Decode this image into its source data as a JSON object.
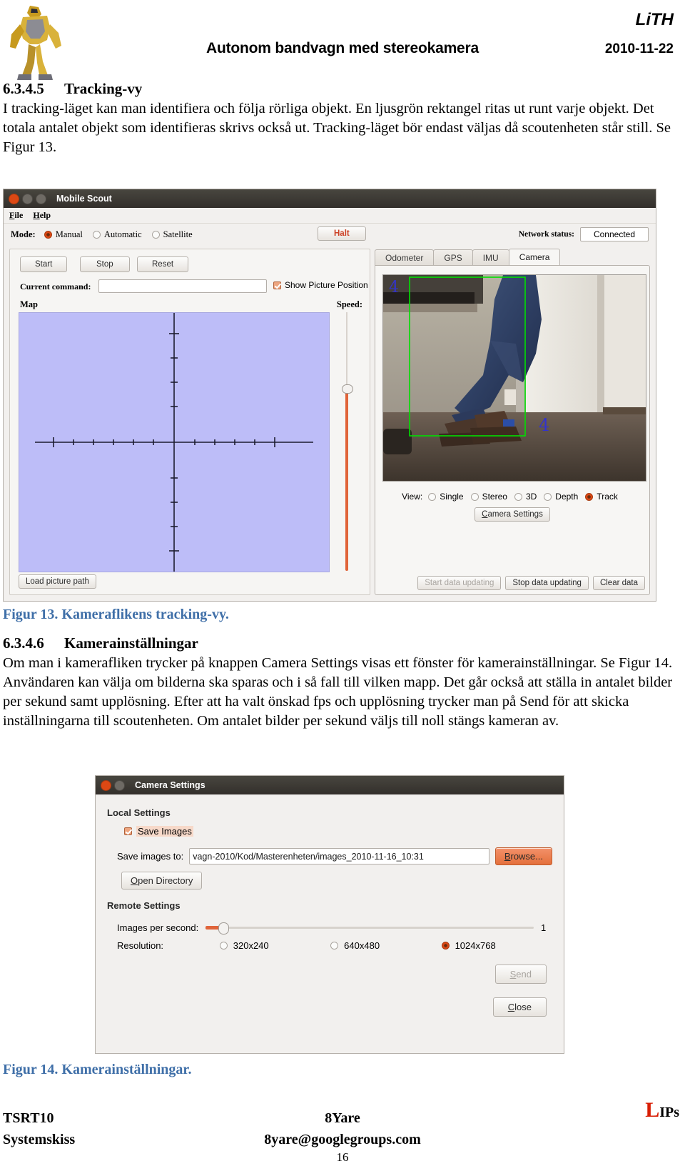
{
  "header": {
    "title": "Autonom bandvagn med stereokamera",
    "org": "LiTH",
    "date": "2010-11-22",
    "logo_alt": "robot-logo"
  },
  "section1": {
    "number": "6.3.4.5",
    "heading": "Tracking-vy",
    "paragraph": "I tracking-läget kan man identifiera och följa rörliga objekt. En ljusgrön rektangel ritas ut runt varje objekt. Det totala antalet objekt som identifieras skrivs också ut. Tracking-läget bör endast väljas då scoutenheten står still. Se Figur 13."
  },
  "figure13": {
    "caption": "Figur 13. Kameraflikens tracking-vy.",
    "window": {
      "title": "Mobile Scout",
      "menu": [
        "File",
        "Help"
      ],
      "mode_label": "Mode:",
      "mode_options": [
        "Manual",
        "Automatic",
        "Satellite"
      ],
      "mode_selected": "Manual",
      "halt_button": "Halt",
      "network_label": "Network status:",
      "network_value": "Connected",
      "buttons": [
        "Start",
        "Stop",
        "Reset"
      ],
      "current_command_label": "Current command:",
      "current_command_value": "",
      "show_picture_position": "Show Picture Position",
      "show_picture_position_checked": true,
      "map_label": "Map",
      "speed_label": "Speed:",
      "load_picture_path": "Load picture path",
      "tabs": [
        "Odometer",
        "GPS",
        "IMU",
        "Camera"
      ],
      "active_tab": "Camera",
      "view_label": "View:",
      "view_options": [
        "Single",
        "Stereo",
        "3D",
        "Depth",
        "Track"
      ],
      "view_selected": "Track",
      "camera_settings_button": "Camera Settings",
      "data_buttons": [
        "Start data updating",
        "Stop data updating",
        "Clear data"
      ],
      "data_buttons_disabled": [
        "Start data updating"
      ],
      "tracking_overlay_labels": [
        "4",
        "4"
      ],
      "tracking_rect_color": "#00e000"
    }
  },
  "section2": {
    "number": "6.3.4.6",
    "heading": "Kamerainställningar",
    "paragraph": "Om man i kamerafliken trycker på knappen Camera Settings visas ett fönster för kamerainställningar. Se Figur 14. Användaren kan välja om bilderna ska sparas och i så fall till vilken mapp. Det går också att ställa in antalet bilder per sekund samt upplösning. Efter att ha valt önskad fps och upplösning trycker man på Send för att skicka inställningarna till scoutenheten. Om antalet bilder per sekund väljs till noll stängs kameran av."
  },
  "figure14": {
    "caption": "Figur 14. Kamerainställningar.",
    "dialog": {
      "title": "Camera Settings",
      "local_settings": "Local Settings",
      "save_images_label": "Save Images",
      "save_images_checked": true,
      "save_images_to_label": "Save images to:",
      "save_images_to_value": "vagn-2010/Kod/Masterenheten/images_2010-11-16_10:31",
      "browse_button": "Browse...",
      "open_directory_button": "Open Directory",
      "remote_settings": "Remote Settings",
      "images_per_second_label": "Images per second:",
      "images_per_second_value": "1",
      "resolution_label": "Resolution:",
      "resolution_options": [
        "320x240",
        "640x480",
        "1024x768"
      ],
      "resolution_selected": "1024x768",
      "send_button": "Send",
      "send_disabled": true,
      "close_button": "Close"
    }
  },
  "footer": {
    "course": "TSRT10",
    "doc_type": "Systemskiss",
    "group": "8Yare",
    "email": "8yare@googlegroups.com",
    "page": "16",
    "brand_l": "L",
    "brand_ips": "IPs"
  },
  "colors": {
    "accent_orange": "#dd4814",
    "caption_blue": "#3f6fa8",
    "map_fill": "#bdbdf8",
    "brand_red": "#d81e05"
  }
}
